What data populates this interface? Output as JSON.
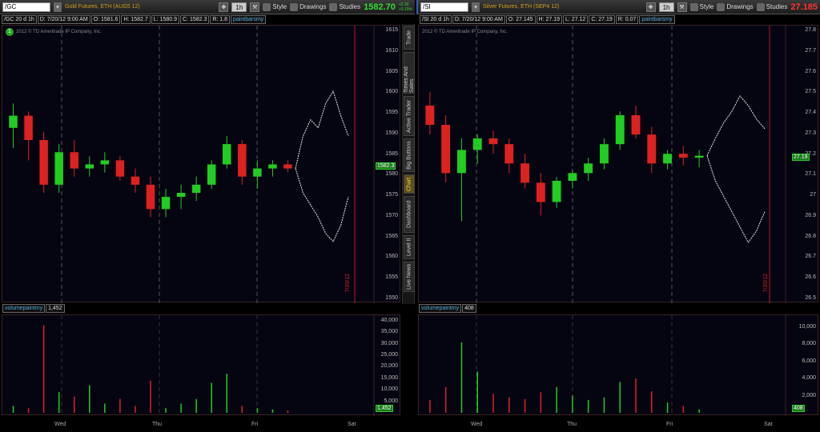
{
  "left": {
    "symbol": "/GC",
    "description": "Gold Futures, ETH (AUG5 12)",
    "period": "1h",
    "style_label": "Style",
    "drawings_label": "Drawings",
    "studies_label": "Studies",
    "last_price": "1582.70",
    "change_line1": "+2.30",
    "change_line2": "+0.15%",
    "change_color": "#33dd33",
    "info": {
      "interval": "/GC 20 d 1h",
      "date": "D: 7/20/12 9:00 AM",
      "open": "O: 1581.6",
      "high": "H: 1582.7",
      "low": "L: 1580.9",
      "close": "C: 1582.3",
      "range": "R: 1.8",
      "study": "paintbarsmy"
    },
    "copyright": "2012 © TD Ameritrade IP Company, Inc.",
    "price_ticks": [
      "1615",
      "1610",
      "1605",
      "1600",
      "1595",
      "1590",
      "1585",
      "1580",
      "1575",
      "1570",
      "1565",
      "1560",
      "1555",
      "1550"
    ],
    "price_range": [
      1550,
      1616
    ],
    "last_tag": "1582.3",
    "expiry_label": "7/20/12",
    "volume_study": "volumepaintmy",
    "volume_value": "1,452",
    "volume_ticks": [
      "40,000",
      "35,000",
      "30,000",
      "25,000",
      "20,000",
      "15,000",
      "10,000",
      "5,000"
    ],
    "volume_max": 41000,
    "volume_tag": "1,452",
    "days": [
      "Wed",
      "Thu",
      "Fri",
      "Sat"
    ],
    "candles": [
      [
        1592,
        1598,
        1587,
        1595
      ],
      [
        1595,
        1596,
        1584,
        1589
      ],
      [
        1589,
        1591,
        1576,
        1578
      ],
      [
        1578,
        1588,
        1576,
        1586
      ],
      [
        1586,
        1589,
        1580,
        1582
      ],
      [
        1582,
        1585,
        1580,
        1583
      ],
      [
        1583,
        1586,
        1581,
        1584
      ],
      [
        1584,
        1585,
        1579,
        1580
      ],
      [
        1580,
        1582,
        1576,
        1578
      ],
      [
        1578,
        1580,
        1570,
        1572
      ],
      [
        1572,
        1577,
        1570,
        1575
      ],
      [
        1575,
        1578,
        1572,
        1576
      ],
      [
        1576,
        1580,
        1574,
        1578
      ],
      [
        1578,
        1584,
        1577,
        1583
      ],
      [
        1583,
        1590,
        1582,
        1588
      ],
      [
        1588,
        1589,
        1578,
        1580
      ],
      [
        1580,
        1584,
        1577,
        1582
      ],
      [
        1582,
        1584,
        1580,
        1583
      ],
      [
        1583,
        1584,
        1581,
        1582
      ]
    ],
    "projection_high": [
      1582,
      1590,
      1594,
      1592,
      1598,
      1601,
      1595,
      1590
    ],
    "projection_low": [
      1582,
      1576,
      1573,
      1570,
      1566,
      1564,
      1568,
      1575
    ],
    "volume": [
      3000,
      2000,
      38000,
      9000,
      7000,
      12000,
      4000,
      6000,
      3000,
      14000,
      2000,
      4000,
      6000,
      13000,
      17000,
      3000,
      2000,
      1500,
      1000
    ]
  },
  "right": {
    "symbol": "/SI",
    "description": "Silver Futures, ETH (SEP4 12)",
    "period": "1h",
    "style_label": "Style",
    "drawings_label": "Drawings",
    "studies_label": "Studies",
    "last_price": "27.185",
    "change_color": "#ff3333",
    "info": {
      "interval": "/SI 20 d 1h",
      "date": "D: 7/20/12 9:00 AM",
      "open": "O: 27.145",
      "high": "H: 27.19",
      "low": "L: 27.12",
      "close": "C: 27.19",
      "range": "R: 0.07",
      "study": "paintbarsmy"
    },
    "copyright": "2012 © TD Ameritrade IP Company, Inc.",
    "price_ticks": [
      "27.8",
      "27.7",
      "27.6",
      "27.5",
      "27.4",
      "27.3",
      "27.2",
      "27.1",
      "27",
      "26.9",
      "26.8",
      "26.7",
      "26.6",
      "26.5"
    ],
    "price_range": [
      26.45,
      27.84
    ],
    "last_tag": "27.19",
    "expiry_label": "7/20/12",
    "volume_study": "volumepaintmy",
    "volume_value": "408",
    "volume_ticks": [
      "10,000",
      "8,000",
      "6,000",
      "4,000",
      "2,000"
    ],
    "volume_max": 11000,
    "volume_tag": "408",
    "days": [
      "Wed",
      "Thu",
      "Fri",
      "Sat"
    ],
    "candles": [
      [
        27.45,
        27.52,
        27.3,
        27.35
      ],
      [
        27.35,
        27.4,
        27.05,
        27.1
      ],
      [
        27.1,
        27.28,
        26.85,
        27.22
      ],
      [
        27.22,
        27.3,
        27.15,
        27.28
      ],
      [
        27.28,
        27.32,
        27.2,
        27.25
      ],
      [
        27.25,
        27.28,
        27.1,
        27.15
      ],
      [
        27.15,
        27.2,
        27.02,
        27.05
      ],
      [
        27.05,
        27.1,
        26.88,
        26.95
      ],
      [
        26.95,
        27.08,
        26.92,
        27.06
      ],
      [
        27.06,
        27.12,
        27.02,
        27.1
      ],
      [
        27.1,
        27.18,
        27.06,
        27.15
      ],
      [
        27.15,
        27.28,
        27.12,
        27.25
      ],
      [
        27.25,
        27.42,
        27.22,
        27.4
      ],
      [
        27.4,
        27.45,
        27.28,
        27.3
      ],
      [
        27.3,
        27.34,
        27.1,
        27.15
      ],
      [
        27.15,
        27.22,
        27.12,
        27.2
      ],
      [
        27.2,
        27.24,
        27.14,
        27.18
      ],
      [
        27.18,
        27.22,
        27.13,
        27.19
      ]
    ],
    "projection_high": [
      27.19,
      27.28,
      27.36,
      27.42,
      27.5,
      27.45,
      27.38,
      27.33
    ],
    "projection_low": [
      27.19,
      27.06,
      26.98,
      26.9,
      26.82,
      26.74,
      26.8,
      26.9
    ],
    "volume": [
      1500,
      3000,
      8200,
      4800,
      2200,
      1800,
      1600,
      2400,
      3000,
      2000,
      1500,
      1800,
      3600,
      4000,
      2500,
      1200,
      800,
      400
    ]
  },
  "side_tabs": [
    "Trade",
    "Times And Sales",
    "Active Trader",
    "Big Buttons",
    "Chart",
    "Dashboard",
    "Level II",
    "Live News"
  ]
}
